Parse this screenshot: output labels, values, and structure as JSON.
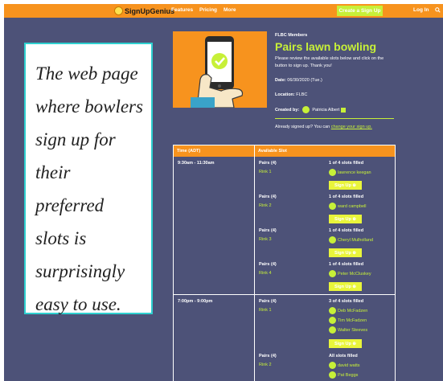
{
  "nav": {
    "logo": "SignUpGenius",
    "links": [
      "Features",
      "Pricing",
      "More"
    ],
    "create": "Create a Sign Up",
    "login": "Log In"
  },
  "caption": {
    "lines": [
      "The web page",
      "where bowlers",
      "sign up for",
      "their preferred",
      "slots is",
      "surprisingly",
      "easy to use."
    ]
  },
  "signup": {
    "group": "FLBC Members",
    "title": "Pairs lawn bowling",
    "description": "Please review the available slots below and click on the button to sign up. Thank you!",
    "date_label": "Date:",
    "date": "06/30/2020 (Tue.)",
    "location_label": "Location:",
    "location": "FLBC",
    "created_label": "Created by:",
    "creator": "Patricia Albert",
    "already_text": "Already signed up? You can",
    "already_link": "change your sign up."
  },
  "table": {
    "headers": [
      "Time (ADT)",
      "Available Slot"
    ],
    "time_slots": [
      {
        "time": "9:30am - 11:30am",
        "slots": [
          {
            "name": "Pairs (4)",
            "rink": "Rink 1",
            "filled": "1 of 4 slots filled",
            "people": [
              "lawrence keegan"
            ],
            "button": "Sign Up"
          },
          {
            "name": "Pairs (4)",
            "rink": "Rink 2",
            "filled": "1 of 4 slots filled",
            "people": [
              "ward campbell"
            ],
            "button": "Sign Up"
          },
          {
            "name": "Pairs (4)",
            "rink": "Rink 3",
            "filled": "1 of 4 slots filled",
            "people": [
              "Cheryl Mulholland"
            ],
            "button": "Sign Up"
          },
          {
            "name": "Pairs (4)",
            "rink": "Rink 4",
            "filled": "1 of 4 slots filled",
            "people": [
              "Peter McCluskey"
            ],
            "button": "Sign Up"
          }
        ]
      },
      {
        "time": "7:00pm - 9:00pm",
        "slots": [
          {
            "name": "Pairs (4)",
            "rink": "Rink 1",
            "filled": "3 of 4 slots filled",
            "people": [
              "Deb McFadzen",
              "Tim McFadzen",
              "Walter Steeves"
            ],
            "button": "Sign Up"
          },
          {
            "name": "Pairs (4)",
            "rink": "Rink 2",
            "filled": "All slots filled",
            "people": [
              "david watts",
              "Pat Beggs"
            ],
            "button": ""
          }
        ]
      }
    ]
  },
  "colors": {
    "accent_orange": "#f7931e",
    "accent_lime": "#c7f038",
    "background": "#4d5278",
    "caption_border": "#2fd0d0"
  },
  "icons": {
    "search": "search-icon",
    "verified": "verified-icon"
  }
}
